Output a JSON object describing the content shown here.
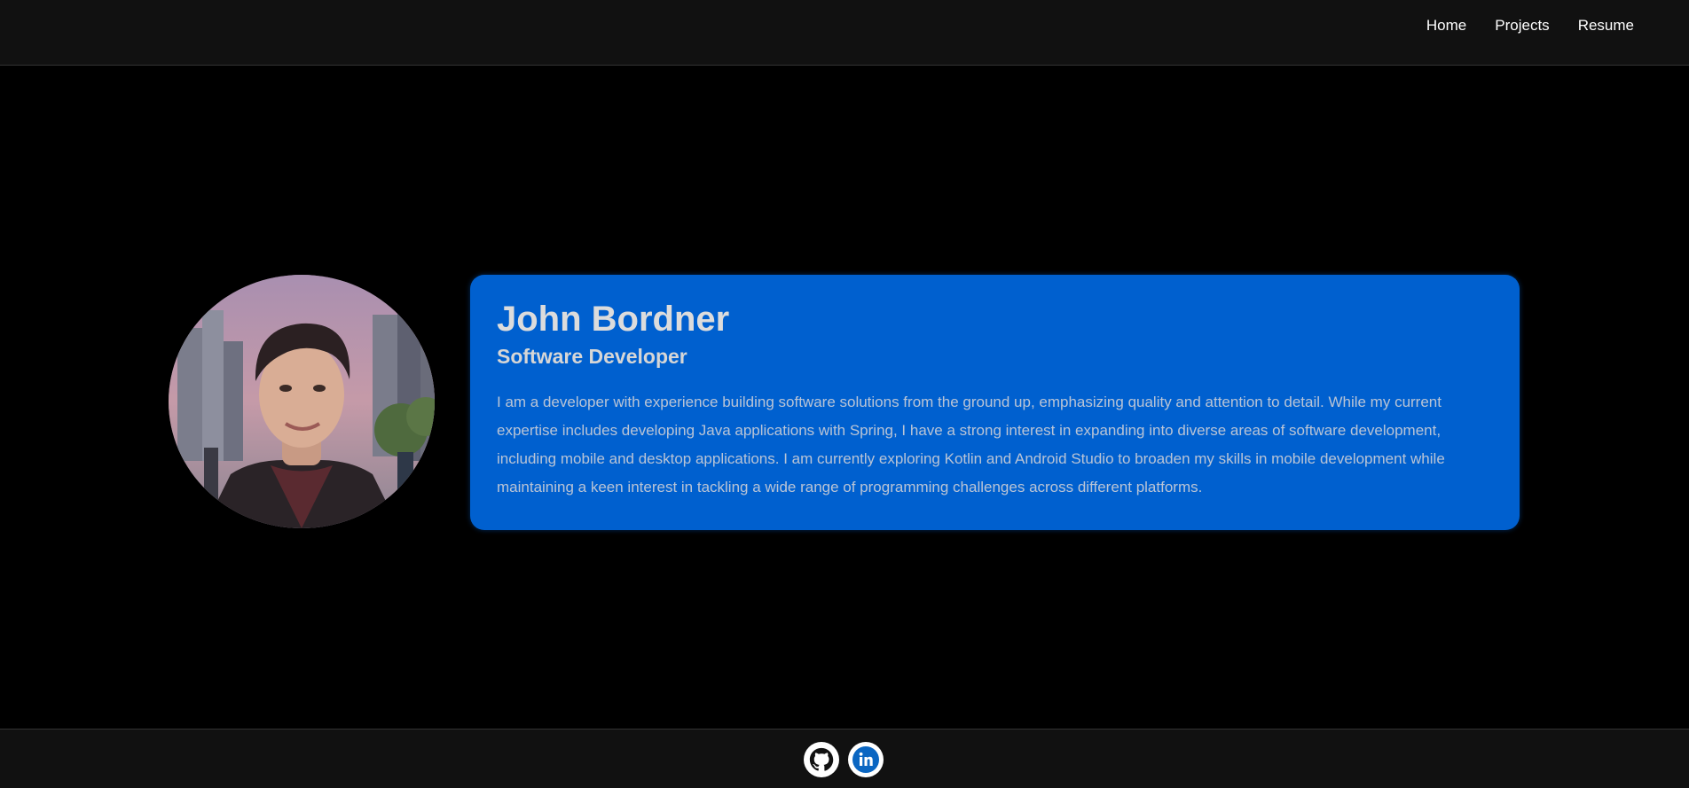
{
  "nav": {
    "items": [
      {
        "label": "Home"
      },
      {
        "label": "Projects"
      },
      {
        "label": "Resume"
      }
    ]
  },
  "profile": {
    "name": "John Bordner",
    "title": "Software Developer",
    "bio": "I am a developer with experience building software solutions from the ground up, emphasizing quality and attention to detail. While my current expertise includes developing Java applications with Spring, I have a strong interest in expanding into diverse areas of software development, including mobile and desktop applications. I am currently exploring Kotlin and Android Studio to broaden my skills in mobile development while maintaining a keen interest in tackling a wide range of programming challenges across different platforms.",
    "photo_icon": "profile-photo"
  },
  "footer": {
    "socials": [
      {
        "icon": "github-icon"
      },
      {
        "icon": "linkedin-icon"
      }
    ]
  },
  "colors": {
    "background": "#000000",
    "bar": "#111111",
    "card": "#0060cf",
    "linkedin": "#0a66c2"
  }
}
